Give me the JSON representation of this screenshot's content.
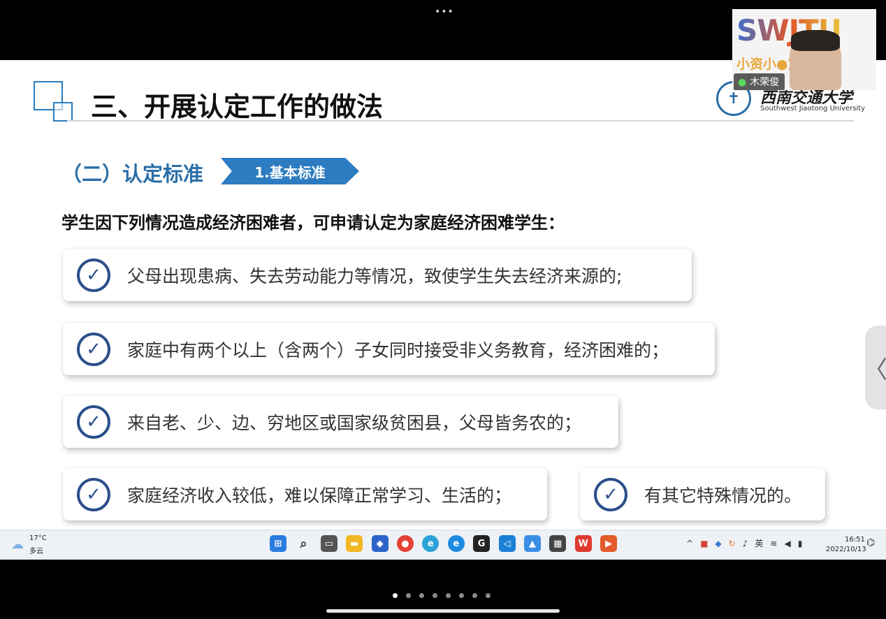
{
  "top": {
    "menu_dots": "•••"
  },
  "slide": {
    "title": "三、开展认定工作的做法",
    "logo": {
      "cn": "西南交通大学",
      "en": "Southwest Jiaotong University"
    },
    "subheading": "（二）认定标准",
    "chip": "1.基本标准",
    "intro": "学生因下列情况造成经济困难者，可申请认定为家庭经济困难学生：",
    "cards": [
      "父母出现患病、失去劳动能力等情况，致使学生失去经济来源的;",
      "家庭中有两个以上（含两个）子女同时接受非义务教育，经济困难的；",
      "来自老、少、边、穷地区或国家级贫困县，父母皆务农的；",
      "家庭经济收入较低，难以保障正常学习、生活的；",
      "有其它特殊情况的。"
    ]
  },
  "camera": {
    "brand": "SWJTU",
    "subtitle": "小资小●宣讲团",
    "speaker": "木荣俊"
  },
  "taskbar": {
    "weather_temp": "17°C",
    "weather_desc": "多云",
    "apps": [
      "start-icon",
      "search-icon",
      "task-view-icon",
      "file-explorer-icon",
      "app-icon",
      "chrome-icon",
      "edge-beta-icon",
      "edge-icon",
      "app-g-icon",
      "vscode-icon",
      "photos-icon",
      "media-icon",
      "wps-icon",
      "player-icon"
    ],
    "tray_lang": "英",
    "time": "16:51",
    "date": "2022/10/13"
  },
  "colors": {
    "accent": "#2a6fa8",
    "check": "#2a4f8a",
    "chip": "#2d7bc0"
  }
}
